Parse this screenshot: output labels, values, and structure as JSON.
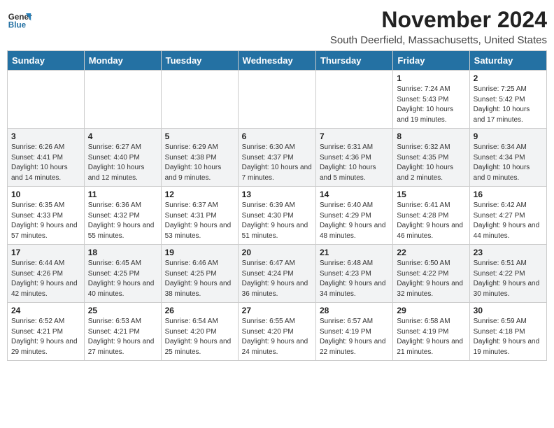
{
  "header": {
    "logo_general": "General",
    "logo_blue": "Blue",
    "month_title": "November 2024",
    "location": "South Deerfield, Massachusetts, United States"
  },
  "days_of_week": [
    "Sunday",
    "Monday",
    "Tuesday",
    "Wednesday",
    "Thursday",
    "Friday",
    "Saturday"
  ],
  "weeks": [
    [
      {
        "day": "",
        "detail": ""
      },
      {
        "day": "",
        "detail": ""
      },
      {
        "day": "",
        "detail": ""
      },
      {
        "day": "",
        "detail": ""
      },
      {
        "day": "",
        "detail": ""
      },
      {
        "day": "1",
        "detail": "Sunrise: 7:24 AM\nSunset: 5:43 PM\nDaylight: 10 hours and 19 minutes."
      },
      {
        "day": "2",
        "detail": "Sunrise: 7:25 AM\nSunset: 5:42 PM\nDaylight: 10 hours and 17 minutes."
      }
    ],
    [
      {
        "day": "3",
        "detail": "Sunrise: 6:26 AM\nSunset: 4:41 PM\nDaylight: 10 hours and 14 minutes."
      },
      {
        "day": "4",
        "detail": "Sunrise: 6:27 AM\nSunset: 4:40 PM\nDaylight: 10 hours and 12 minutes."
      },
      {
        "day": "5",
        "detail": "Sunrise: 6:29 AM\nSunset: 4:38 PM\nDaylight: 10 hours and 9 minutes."
      },
      {
        "day": "6",
        "detail": "Sunrise: 6:30 AM\nSunset: 4:37 PM\nDaylight: 10 hours and 7 minutes."
      },
      {
        "day": "7",
        "detail": "Sunrise: 6:31 AM\nSunset: 4:36 PM\nDaylight: 10 hours and 5 minutes."
      },
      {
        "day": "8",
        "detail": "Sunrise: 6:32 AM\nSunset: 4:35 PM\nDaylight: 10 hours and 2 minutes."
      },
      {
        "day": "9",
        "detail": "Sunrise: 6:34 AM\nSunset: 4:34 PM\nDaylight: 10 hours and 0 minutes."
      }
    ],
    [
      {
        "day": "10",
        "detail": "Sunrise: 6:35 AM\nSunset: 4:33 PM\nDaylight: 9 hours and 57 minutes."
      },
      {
        "day": "11",
        "detail": "Sunrise: 6:36 AM\nSunset: 4:32 PM\nDaylight: 9 hours and 55 minutes."
      },
      {
        "day": "12",
        "detail": "Sunrise: 6:37 AM\nSunset: 4:31 PM\nDaylight: 9 hours and 53 minutes."
      },
      {
        "day": "13",
        "detail": "Sunrise: 6:39 AM\nSunset: 4:30 PM\nDaylight: 9 hours and 51 minutes."
      },
      {
        "day": "14",
        "detail": "Sunrise: 6:40 AM\nSunset: 4:29 PM\nDaylight: 9 hours and 48 minutes."
      },
      {
        "day": "15",
        "detail": "Sunrise: 6:41 AM\nSunset: 4:28 PM\nDaylight: 9 hours and 46 minutes."
      },
      {
        "day": "16",
        "detail": "Sunrise: 6:42 AM\nSunset: 4:27 PM\nDaylight: 9 hours and 44 minutes."
      }
    ],
    [
      {
        "day": "17",
        "detail": "Sunrise: 6:44 AM\nSunset: 4:26 PM\nDaylight: 9 hours and 42 minutes."
      },
      {
        "day": "18",
        "detail": "Sunrise: 6:45 AM\nSunset: 4:25 PM\nDaylight: 9 hours and 40 minutes."
      },
      {
        "day": "19",
        "detail": "Sunrise: 6:46 AM\nSunset: 4:25 PM\nDaylight: 9 hours and 38 minutes."
      },
      {
        "day": "20",
        "detail": "Sunrise: 6:47 AM\nSunset: 4:24 PM\nDaylight: 9 hours and 36 minutes."
      },
      {
        "day": "21",
        "detail": "Sunrise: 6:48 AM\nSunset: 4:23 PM\nDaylight: 9 hours and 34 minutes."
      },
      {
        "day": "22",
        "detail": "Sunrise: 6:50 AM\nSunset: 4:22 PM\nDaylight: 9 hours and 32 minutes."
      },
      {
        "day": "23",
        "detail": "Sunrise: 6:51 AM\nSunset: 4:22 PM\nDaylight: 9 hours and 30 minutes."
      }
    ],
    [
      {
        "day": "24",
        "detail": "Sunrise: 6:52 AM\nSunset: 4:21 PM\nDaylight: 9 hours and 29 minutes."
      },
      {
        "day": "25",
        "detail": "Sunrise: 6:53 AM\nSunset: 4:21 PM\nDaylight: 9 hours and 27 minutes."
      },
      {
        "day": "26",
        "detail": "Sunrise: 6:54 AM\nSunset: 4:20 PM\nDaylight: 9 hours and 25 minutes."
      },
      {
        "day": "27",
        "detail": "Sunrise: 6:55 AM\nSunset: 4:20 PM\nDaylight: 9 hours and 24 minutes."
      },
      {
        "day": "28",
        "detail": "Sunrise: 6:57 AM\nSunset: 4:19 PM\nDaylight: 9 hours and 22 minutes."
      },
      {
        "day": "29",
        "detail": "Sunrise: 6:58 AM\nSunset: 4:19 PM\nDaylight: 9 hours and 21 minutes."
      },
      {
        "day": "30",
        "detail": "Sunrise: 6:59 AM\nSunset: 4:18 PM\nDaylight: 9 hours and 19 minutes."
      }
    ]
  ]
}
